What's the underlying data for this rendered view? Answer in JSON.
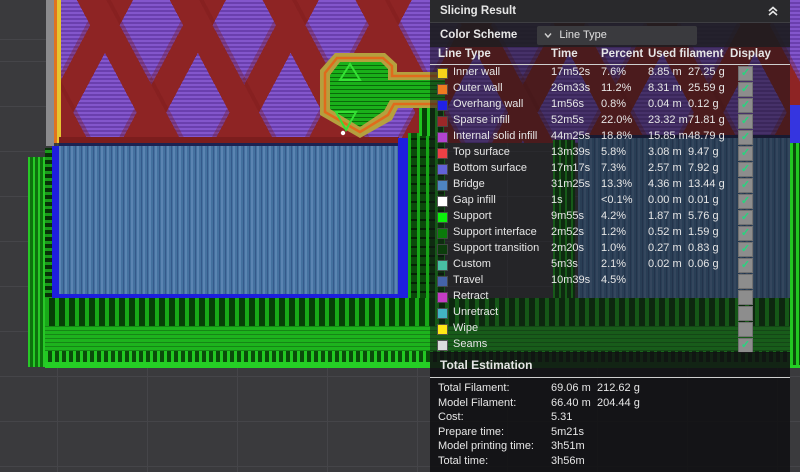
{
  "panel": {
    "title": "Slicing Result",
    "color_scheme_label": "Color Scheme",
    "color_scheme_value": "Line Type",
    "columns": [
      "Line Type",
      "Time",
      "Percent",
      "Used filament",
      "Display"
    ],
    "check_glyph": "✓",
    "rows": [
      {
        "label": "Inner wall",
        "color": "#f6d31a",
        "time": "17m52s",
        "percent": "7.6%",
        "filament_m": "8.85 m",
        "filament_g": "27.25 g",
        "display": true
      },
      {
        "label": "Outer wall",
        "color": "#ee7a21",
        "time": "26m33s",
        "percent": "11.2%",
        "filament_m": "8.31 m",
        "filament_g": "25.59 g",
        "display": true
      },
      {
        "label": "Overhang wall",
        "color": "#2121e8",
        "time": "1m56s",
        "percent": "0.8%",
        "filament_m": "0.04 m",
        "filament_g": "0.12 g",
        "display": true
      },
      {
        "label": "Sparse infill",
        "color": "#9c2828",
        "time": "52m5s",
        "percent": "22.0%",
        "filament_m": "23.32 m",
        "filament_g": "71.81 g",
        "display": true
      },
      {
        "label": "Internal solid infill",
        "color": "#b243cf",
        "time": "44m25s",
        "percent": "18.8%",
        "filament_m": "15.85 m",
        "filament_g": "48.79 g",
        "display": true
      },
      {
        "label": "Top surface",
        "color": "#ed4045",
        "time": "13m39s",
        "percent": "5.8%",
        "filament_m": "3.08 m",
        "filament_g": "9.47 g",
        "display": true
      },
      {
        "label": "Bottom surface",
        "color": "#6262d8",
        "time": "17m17s",
        "percent": "7.3%",
        "filament_m": "2.57 m",
        "filament_g": "7.92 g",
        "display": true
      },
      {
        "label": "Bridge",
        "color": "#4e84c0",
        "time": "31m25s",
        "percent": "13.3%",
        "filament_m": "4.36 m",
        "filament_g": "13.44 g",
        "display": true
      },
      {
        "label": "Gap infill",
        "color": "#ffffff",
        "time": "1s",
        "percent": "<0.1%",
        "filament_m": "0.00 m",
        "filament_g": "0.01 g",
        "display": true
      },
      {
        "label": "Support",
        "color": "#0cf00c",
        "time": "9m55s",
        "percent": "4.2%",
        "filament_m": "1.87 m",
        "filament_g": "5.76 g",
        "display": true
      },
      {
        "label": "Support interface",
        "color": "#0b7a0b",
        "time": "2m52s",
        "percent": "1.2%",
        "filament_m": "0.52 m",
        "filament_g": "1.59 g",
        "display": true
      },
      {
        "label": "Support transition",
        "color": "#0c3d0c",
        "time": "2m20s",
        "percent": "1.0%",
        "filament_m": "0.27 m",
        "filament_g": "0.83 g",
        "display": true
      },
      {
        "label": "Custom",
        "color": "#48bfa4",
        "time": "5m3s",
        "percent": "2.1%",
        "filament_m": "0.02 m",
        "filament_g": "0.06 g",
        "display": true
      },
      {
        "label": "Travel",
        "color": "#4463a8",
        "time": "10m39s",
        "percent": "4.5%",
        "filament_m": "",
        "filament_g": "",
        "display": false
      },
      {
        "label": "Retract",
        "color": "#c43cc4",
        "time": "",
        "percent": "",
        "filament_m": "",
        "filament_g": "",
        "display": false
      },
      {
        "label": "Unretract",
        "color": "#42b4c4",
        "time": "",
        "percent": "",
        "filament_m": "",
        "filament_g": "",
        "display": false
      },
      {
        "label": "Wipe",
        "color": "#ffe816",
        "time": "",
        "percent": "",
        "filament_m": "",
        "filament_g": "",
        "display": false
      },
      {
        "label": "Seams",
        "color": "#dcdcdc",
        "time": "",
        "percent": "",
        "filament_m": "",
        "filament_g": "",
        "display": true
      }
    ],
    "total_estimation": {
      "title": "Total Estimation",
      "rows": [
        {
          "label": "Total Filament:",
          "v1": "69.06 m",
          "v2": "212.62 g"
        },
        {
          "label": "Model Filament:",
          "v1": "66.40 m",
          "v2": "204.44 g"
        },
        {
          "label": "Cost:",
          "v1": "5.31",
          "v2": ""
        },
        {
          "label": "Prepare time:",
          "v1": "5m21s",
          "v2": ""
        },
        {
          "label": "Model printing time:",
          "v1": "3h51m",
          "v2": ""
        },
        {
          "label": "Total time:",
          "v1": "3h56m",
          "v2": ""
        }
      ]
    }
  },
  "viewport": {
    "background_color": "#3a3a3d",
    "grid_color": "#454549",
    "sparse_infill_color": "#8e2424",
    "internal_infill_color": "#7a4dbd",
    "bridge_slab_color": "#44719f",
    "overhang_wall_color": "#1e1ede",
    "support_green_color": "#1db31d",
    "island_outline_color": "#b5a03e"
  }
}
